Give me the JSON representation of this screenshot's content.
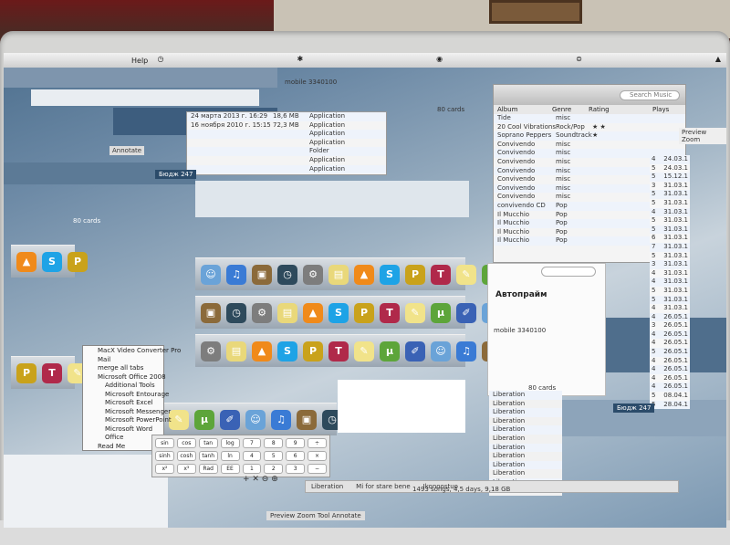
{
  "menubar": {
    "help": "Help",
    "tray": [
      "◷",
      "✱",
      "◉",
      "⊜",
      "▲"
    ]
  },
  "itunes": {
    "search_placeholder": "Search Music",
    "columns": {
      "album": "Album",
      "genre": "Genre",
      "rating": "Rating",
      "plays": "Plays"
    },
    "rows": [
      {
        "album": "Tide",
        "genre": "misc",
        "rating": "",
        "play": ""
      },
      {
        "album": "20 Cool Vibrations",
        "genre": "Rock/Pop",
        "rating": "★ ★",
        "play": ""
      },
      {
        "album": "Soprano Peppers",
        "genre": "Soundtrack",
        "rating": "★",
        "play": ""
      },
      {
        "album": "Convivendo",
        "genre": "misc",
        "rating": "",
        "play": ""
      },
      {
        "album": "Convivendo",
        "genre": "misc",
        "rating": "",
        "play": ""
      },
      {
        "album": "Convivendo",
        "genre": "misc",
        "rating": "",
        "play": ""
      },
      {
        "album": "Convivendo",
        "genre": "misc",
        "rating": "",
        "play": ""
      },
      {
        "album": "Convivendo",
        "genre": "misc",
        "rating": "",
        "play": ""
      },
      {
        "album": "Convivendo",
        "genre": "misc",
        "rating": "",
        "play": ""
      },
      {
        "album": "Convivendo",
        "genre": "misc",
        "rating": "",
        "play": ""
      },
      {
        "album": "convivendo CD",
        "genre": "Pop",
        "rating": "",
        "play": ""
      },
      {
        "album": "Il Mucchio",
        "genre": "Pop",
        "rating": "",
        "play": ""
      },
      {
        "album": "Il Mucchio",
        "genre": "Pop",
        "rating": "",
        "play": ""
      },
      {
        "album": "Il Mucchio",
        "genre": "Pop",
        "rating": "",
        "play": ""
      },
      {
        "album": "Il Mucchio",
        "genre": "Pop",
        "rating": "",
        "play": ""
      }
    ],
    "plays": [
      {
        "n": "4",
        "d": "24.03.1"
      },
      {
        "n": "5",
        "d": "24.03.1"
      },
      {
        "n": "5",
        "d": "15.12.1"
      },
      {
        "n": "3",
        "d": "31.03.1"
      },
      {
        "n": "5",
        "d": "31.03.1"
      },
      {
        "n": "5",
        "d": "31.03.1"
      },
      {
        "n": "4",
        "d": "31.03.1"
      },
      {
        "n": "5",
        "d": "31.03.1"
      },
      {
        "n": "5",
        "d": "31.03.1"
      },
      {
        "n": "6",
        "d": "31.03.1"
      },
      {
        "n": "7",
        "d": "31.03.1"
      },
      {
        "n": "5",
        "d": "31.03.1"
      },
      {
        "n": "3",
        "d": "31.03.1"
      },
      {
        "n": "4",
        "d": "31.03.1"
      },
      {
        "n": "4",
        "d": "31.03.1"
      },
      {
        "n": "5",
        "d": "31.03.1"
      },
      {
        "n": "5",
        "d": "31.03.1"
      },
      {
        "n": "4",
        "d": "31.03.1"
      },
      {
        "n": "4",
        "d": "26.05.1"
      },
      {
        "n": "3",
        "d": "26.05.1"
      },
      {
        "n": "4",
        "d": "26.05.1"
      },
      {
        "n": "4",
        "d": "26.05.1"
      },
      {
        "n": "5",
        "d": "26.05.1"
      },
      {
        "n": "4",
        "d": "26.05.1"
      },
      {
        "n": "4",
        "d": "26.05.1"
      },
      {
        "n": "4",
        "d": "26.05.1"
      },
      {
        "n": "4",
        "d": "26.05.1"
      },
      {
        "n": "5",
        "d": "08.04.1"
      },
      {
        "n": "5",
        "d": "28.04.1"
      }
    ]
  },
  "finder": {
    "rows": [
      {
        "date": "24 марта 2013 г. 16:29",
        "size": "18,6 MB",
        "kind": "Application"
      },
      {
        "date": "16 ноября 2010 г. 15:15",
        "size": "72,3 MB",
        "kind": "Application"
      },
      {
        "date": "",
        "size": "",
        "kind": "Application"
      },
      {
        "date": "",
        "size": "",
        "kind": "Application"
      },
      {
        "date": "",
        "size": "",
        "kind": "Folder"
      },
      {
        "date": "",
        "size": "",
        "kind": "Application"
      },
      {
        "date": "",
        "size": "",
        "kind": "Application"
      }
    ],
    "cards_label": "80 cards",
    "mobile_label": "mobile 3340100"
  },
  "contact": {
    "title": "Автопрайм",
    "mobile": "mobile 3340100",
    "footer": "80 cards"
  },
  "menu_items": [
    "MacX Video Converter Pro",
    "Mail",
    "merge all tabs",
    "Microsoft Office 2008",
    "Additional Tools",
    "Microsoft Entourage",
    "Microsoft Excel",
    "Microsoft Messenger",
    "Microsoft PowerPoint",
    "Microsoft Word",
    "Office",
    "Read Me"
  ],
  "calculator": {
    "keys": [
      "sin",
      "cos",
      "tan",
      "log",
      "7",
      "8",
      "9",
      "÷",
      "sinh",
      "cosh",
      "tanh",
      "ln",
      "4",
      "5",
      "6",
      "×",
      "x²",
      "x³",
      "Rad",
      "EE",
      "1",
      "2",
      "3",
      "−"
    ]
  },
  "bottom": {
    "songs_status": "1493 songs, 4,5 days, 9,18 GB",
    "me_song": "Mi for stare bene",
    "artist": "Ikonoostuo",
    "preview_menu": "Preview  Zoom  Tool  Annotate"
  },
  "labels": {
    "liberation": "Liberation",
    "budget": "Бюдж 247",
    "annotate": "Annotate",
    "preview_zoom": "Preview  Zoom"
  },
  "dock_icons": [
    "finder-icon",
    "itunes-icon",
    "preview-icon",
    "timemachine-icon",
    "settings-icon",
    "stickies-icon",
    "vlc-icon",
    "skype-icon",
    "pathfinder-icon",
    "textmate-icon",
    "notes-icon",
    "utorrent-icon",
    "brush-icon"
  ]
}
